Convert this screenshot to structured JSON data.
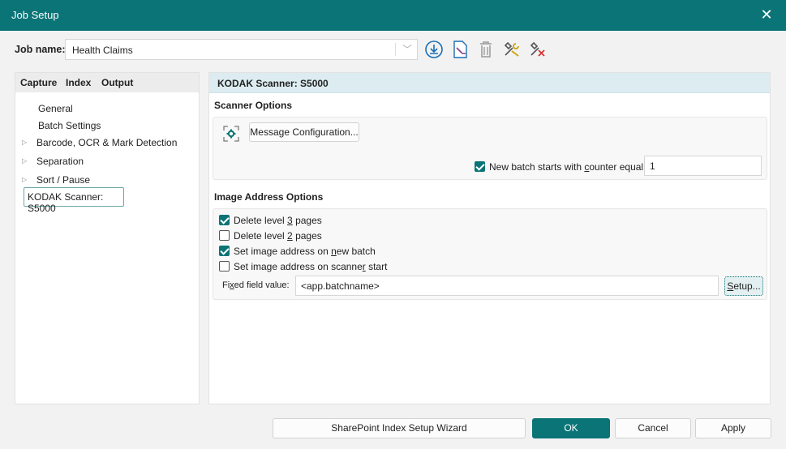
{
  "window": {
    "title": "Job Setup"
  },
  "job": {
    "label": "Job name:",
    "value": "Health Claims"
  },
  "tabs": [
    "Capture",
    "Index",
    "Output"
  ],
  "tree": {
    "items": [
      {
        "label": "General",
        "expandable": false
      },
      {
        "label": "Batch Settings",
        "expandable": false
      },
      {
        "label": "Barcode, OCR & Mark Detection",
        "expandable": true
      },
      {
        "label": "Separation",
        "expandable": true
      },
      {
        "label": "Sort / Pause",
        "expandable": true
      }
    ],
    "selected": "KODAK Scanner: S5000"
  },
  "panel": {
    "header": "KODAK Scanner: S5000",
    "scanner_options": {
      "title": "Scanner Options",
      "message_button": "Message Configuration...",
      "new_batch_label": "New batch starts with counter equal to:",
      "new_batch_checked": true,
      "counter_value": "1"
    },
    "image_address": {
      "title": "Image Address Options",
      "options": [
        {
          "label": "Delete level 3 pages",
          "checked": true
        },
        {
          "label": "Delete level 2 pages",
          "checked": false
        },
        {
          "label": "Set image address on new batch",
          "checked": true
        },
        {
          "label": "Set image address on scanner start",
          "checked": false
        }
      ],
      "fixed_field_label": "Fixed field value:",
      "fixed_field_value": "<app.batchname>",
      "setup_button": "Setup..."
    }
  },
  "footer": {
    "wizard": "SharePoint Index Setup Wizard",
    "ok": "OK",
    "cancel": "Cancel",
    "apply": "Apply"
  },
  "colors": {
    "accent": "#0a7477",
    "header_bg": "#dcecf0"
  }
}
